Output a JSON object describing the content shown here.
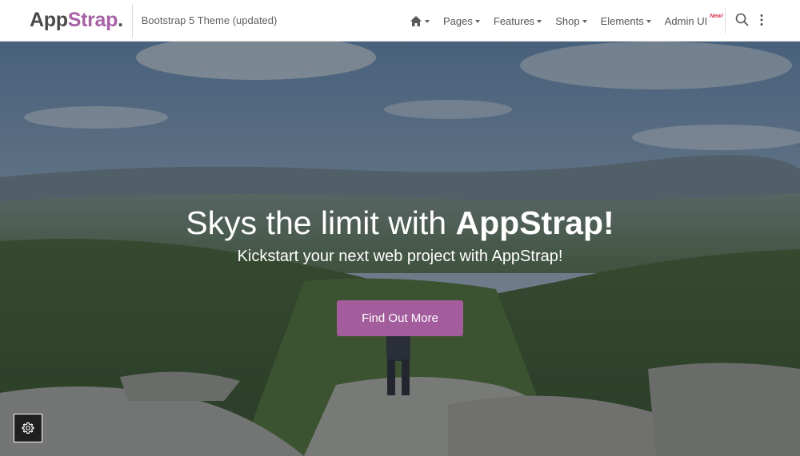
{
  "navbar": {
    "brand_main": "App",
    "brand_accent": "Strap",
    "brand_dot": ".",
    "tagline": "Bootstrap 5 Theme (updated)",
    "menu": [
      {
        "label": "Pages"
      },
      {
        "label": "Features"
      },
      {
        "label": "Shop"
      },
      {
        "label": "Elements"
      },
      {
        "label": "Admin UI",
        "badge": "New!"
      }
    ]
  },
  "hero": {
    "title_regular": "Skys the limit with ",
    "title_bold": "AppStrap!",
    "subtitle": "Kickstart your next web project with AppStrap!",
    "cta_label": "Find Out More"
  },
  "colors": {
    "brand_accent": "#a861a5",
    "cta_background": "#a35d9c",
    "badge_new": "#d6334a"
  },
  "icons": [
    "home-icon",
    "caret-down-icon",
    "search-icon",
    "more-vertical-icon",
    "gear-icon"
  ]
}
